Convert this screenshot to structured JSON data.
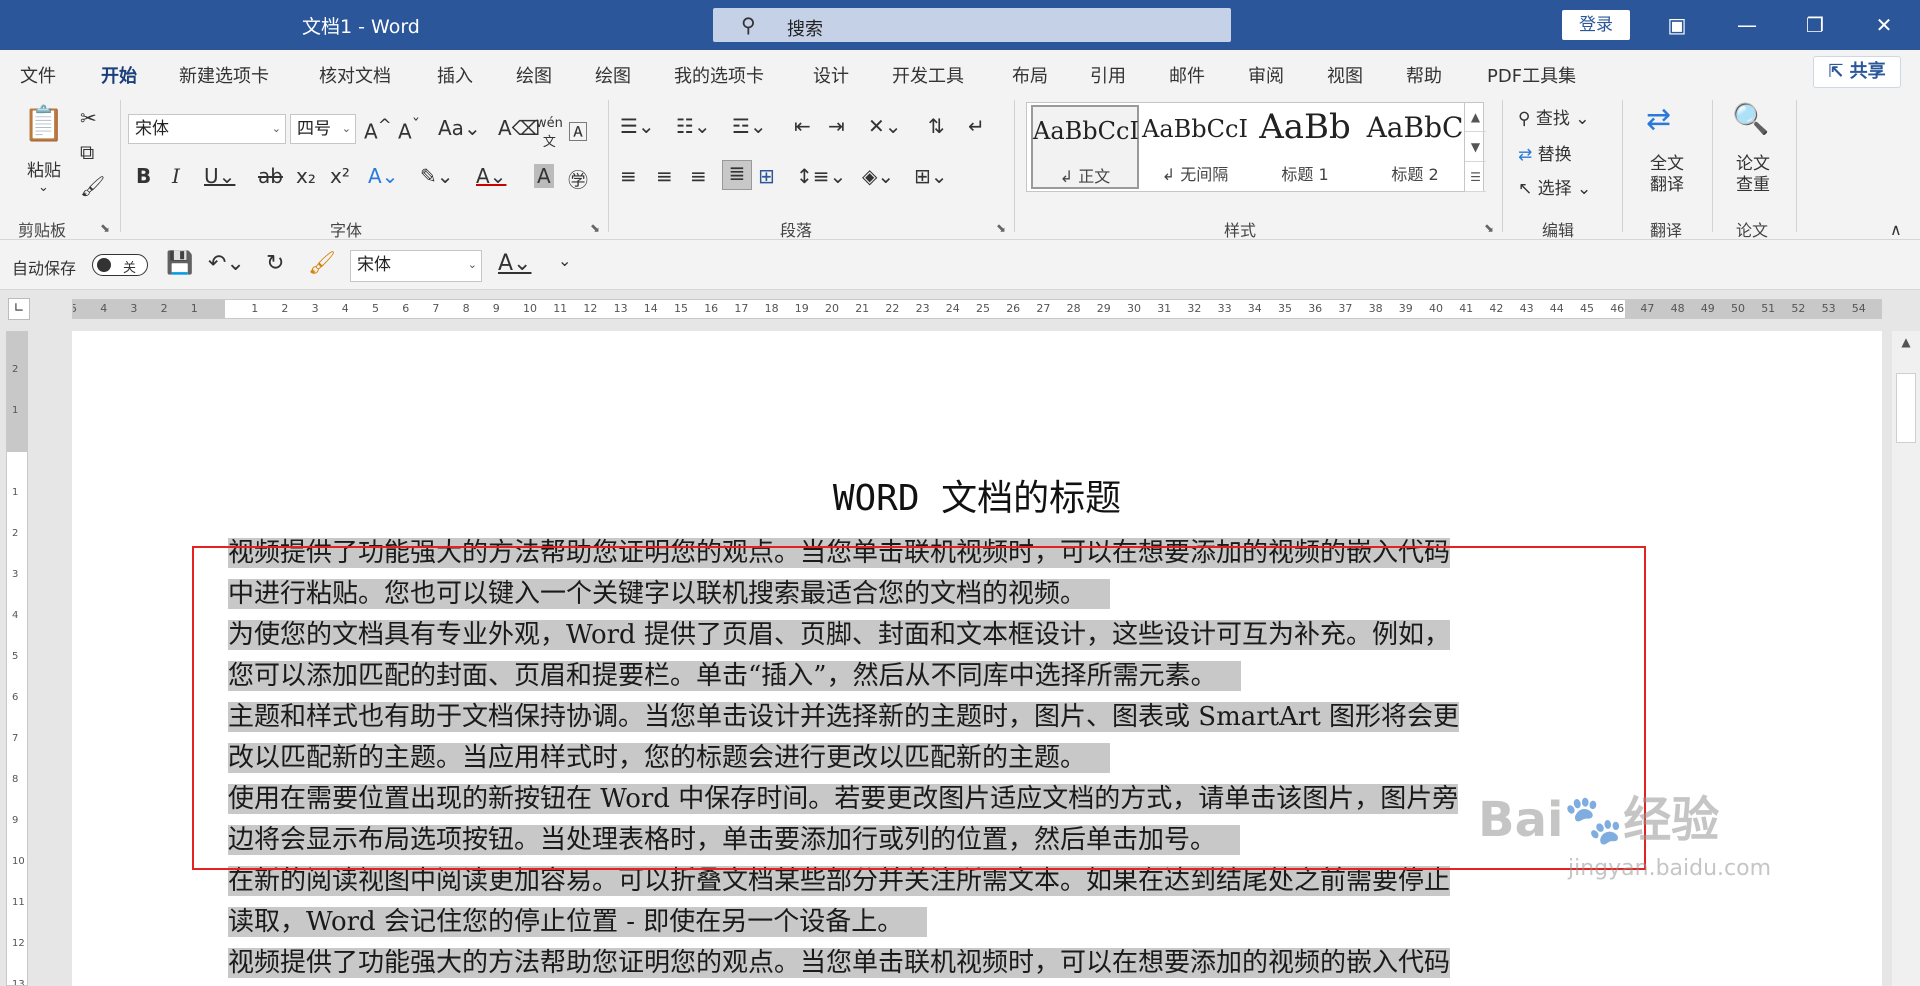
{
  "titlebar": {
    "doc_name": "文档1 - Word",
    "search_placeholder": "搜索",
    "login_label": "登录"
  },
  "tabs": [
    "文件",
    "开始",
    "新建选项卡",
    "核对文档",
    "插入",
    "绘图",
    "绘图",
    "我的选项卡",
    "设计",
    "开发工具",
    "布局",
    "引用",
    "邮件",
    "审阅",
    "视图",
    "帮助",
    "PDF工具集"
  ],
  "active_tab": "开始",
  "share_label": "共享",
  "ribbon": {
    "clipboard": {
      "paste": "粘贴",
      "label": "剪贴板"
    },
    "font": {
      "name": "宋体",
      "size": "四号",
      "label": "字体"
    },
    "paragraph": {
      "label": "段落"
    },
    "styles": {
      "label": "样式",
      "items": [
        {
          "preview": "AaBbCcI",
          "name": "↲ 正文"
        },
        {
          "preview": "AaBbCcI",
          "name": "↲ 无间隔"
        },
        {
          "preview": "AaBb",
          "name": "标题 1"
        },
        {
          "preview": "AaBbC",
          "name": "标题 2"
        }
      ]
    },
    "editing": {
      "find": "查找",
      "replace": "替换",
      "select": "选择",
      "label": "编辑"
    },
    "translate": {
      "button": "全文\n翻译",
      "label": "翻译"
    },
    "paper": {
      "button": "论文\n查重",
      "label": "论文"
    }
  },
  "qat": {
    "autosave_label": "自动保存",
    "autosave_state": "关",
    "font_name": "宋体"
  },
  "document": {
    "title": "WORD 文档的标题",
    "lines": [
      "视频提供了功能强大的方法帮助您证明您的观点。当您单击联机视频时，可以在想要添加的视频的嵌入代码",
      "中进行粘贴。您也可以键入一个关键字以联机搜索最适合您的文档的视频。",
      "为使您的文档具有专业外观，Word 提供了页眉、页脚、封面和文本框设计，这些设计可互为补充。例如，",
      "您可以添加匹配的封面、页眉和提要栏。单击“插入”，然后从不同库中选择所需元素。",
      "主题和样式也有助于文档保持协调。当您单击设计并选择新的主题时，图片、图表或 SmartArt 图形将会更",
      "改以匹配新的主题。当应用样式时，您的标题会进行更改以匹配新的主题。",
      "使用在需要位置出现的新按钮在 Word 中保存时间。若要更改图片适应文档的方式，请单击该图片，图片旁",
      "边将会显示布局选项按钮。当处理表格时，单击要添加行或列的位置，然后单击加号。",
      "在新的阅读视图中阅读更加容易。可以折叠文档某些部分并关注所需文本。如果在达到结尾处之前需要停止",
      "读取，Word 会记住您的停止位置 - 即使在另一个设备上。",
      "视频提供了功能强大的方法帮助您证明您的观点。当您单击联机视频时，可以在想要添加的视频的嵌入代码"
    ]
  },
  "watermark": {
    "brand": "Bai",
    "brand_cn": "经验",
    "url": "jingyan.baidu.com"
  }
}
